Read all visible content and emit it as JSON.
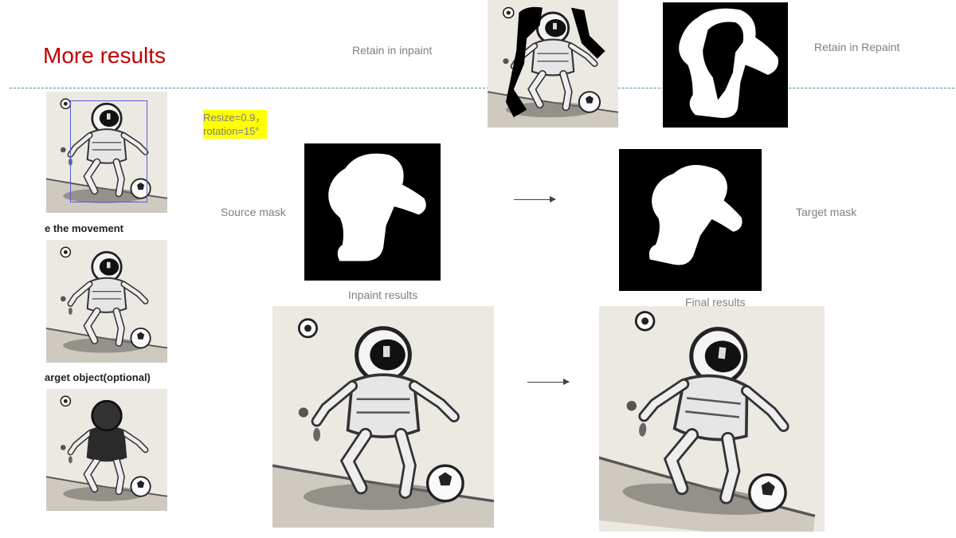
{
  "slide": {
    "title": "More results",
    "labels": {
      "retain_inpaint": "Retain in inpaint",
      "retain_repaint": "Retain in Repaint",
      "source_mask": "Source mask",
      "target_mask": "Target mask",
      "inpaint_results": "Inpaint results",
      "final_results": "Final results"
    },
    "params": {
      "resize": "Resize=0.9，",
      "rotation": "rotation=15°"
    },
    "left_captions": {
      "movement": "e the movement",
      "target_object": "arget object(optional)"
    }
  },
  "colors": {
    "title": "#c00000",
    "highlight": "#ffff00",
    "bbox": "#5b5bd6",
    "divider": "#3a8fa0"
  }
}
